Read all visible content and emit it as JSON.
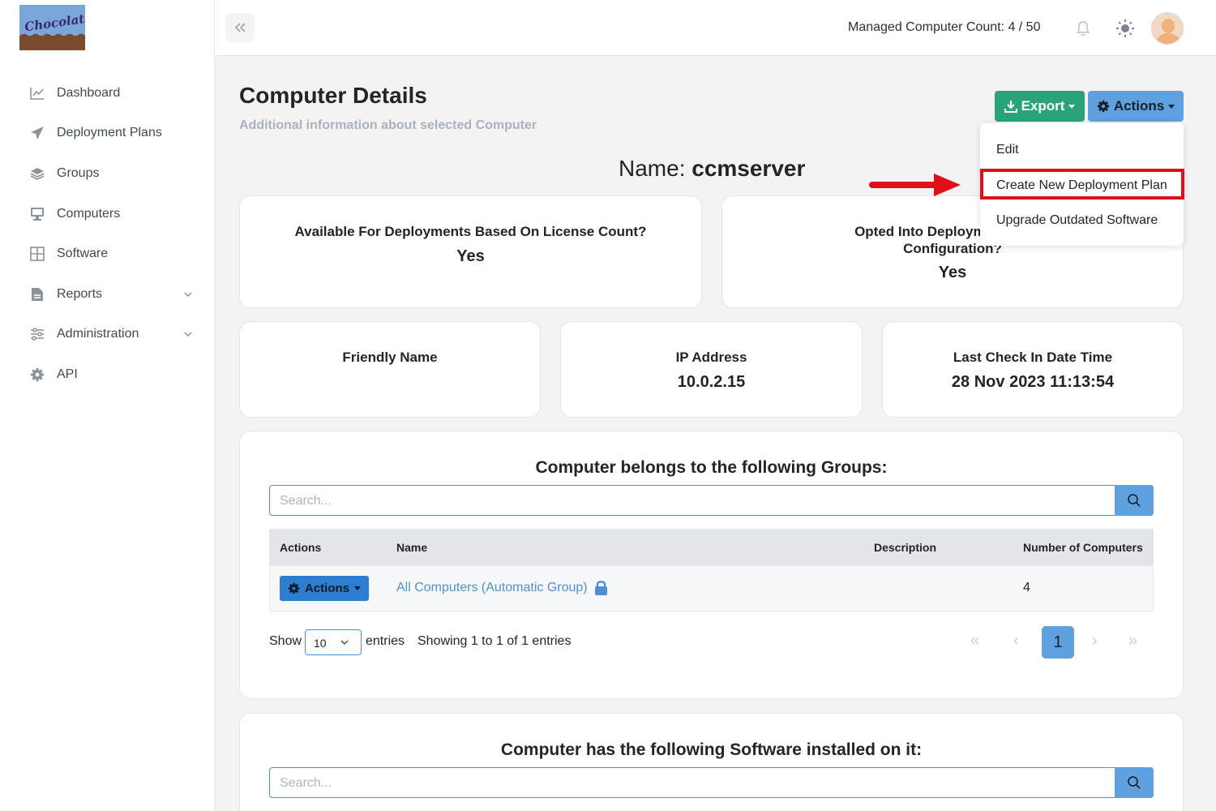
{
  "app": {
    "logo_text": "Chocolatey"
  },
  "sidebar": {
    "items": [
      {
        "label": "Dashboard",
        "icon": "chart-line-icon"
      },
      {
        "label": "Deployment Plans",
        "icon": "paper-plane-icon"
      },
      {
        "label": "Groups",
        "icon": "layers-icon"
      },
      {
        "label": "Computers",
        "icon": "desktop-icon"
      },
      {
        "label": "Software",
        "icon": "grid-icon"
      },
      {
        "label": "Reports",
        "icon": "file-icon",
        "expandable": true
      },
      {
        "label": "Administration",
        "icon": "sliders-icon",
        "expandable": true
      },
      {
        "label": "API",
        "icon": "gear-icon"
      }
    ]
  },
  "topbar": {
    "managed_count": "Managed Computer Count: 4 / 50"
  },
  "page": {
    "title": "Computer Details",
    "subtitle": "Additional information about selected Computer",
    "export_label": "Export",
    "actions_label": "Actions",
    "name_label": "Name:",
    "name_value": "ccmserver"
  },
  "dropdown": {
    "items": [
      "Edit",
      "Create New Deployment Plan",
      "Upgrade Outdated Software"
    ],
    "highlighted": "Create New Deployment Plan"
  },
  "cards": {
    "license": {
      "label": "Available For Deployments Based On License Count?",
      "value": "Yes"
    },
    "opted": {
      "label_line1": "Opted Into Deployments Base",
      "label_line2": "Configuration?",
      "value": "Yes"
    },
    "friendly": {
      "label": "Friendly Name",
      "value": ""
    },
    "ip": {
      "label": "IP Address",
      "value": "10.0.2.15"
    },
    "checkin": {
      "label": "Last Check In Date Time",
      "value": "28 Nov 2023 11:13:54"
    }
  },
  "groups": {
    "title": "Computer belongs to the following Groups:",
    "search_placeholder": "Search...",
    "columns": [
      "Actions",
      "Name",
      "Description",
      "Number of Computers"
    ],
    "rows": [
      {
        "action": "Actions",
        "name": "All Computers (Automatic Group)",
        "description": "",
        "count": "4"
      }
    ],
    "show_label": "Show",
    "page_size": "10",
    "entries_label": "entries",
    "info": "Showing 1 to 1 of 1 entries",
    "pager": {
      "first": "«",
      "prev": "‹",
      "current": "1",
      "next": "›",
      "last": "»"
    }
  },
  "software": {
    "title": "Computer has the following Software installed on it:",
    "search_placeholder": "Search..."
  },
  "colors": {
    "export_green": "#2ba37a",
    "actions_blue": "#5fa0df",
    "highlight_red": "#e0101a",
    "link_blue": "#4f8fd4"
  }
}
